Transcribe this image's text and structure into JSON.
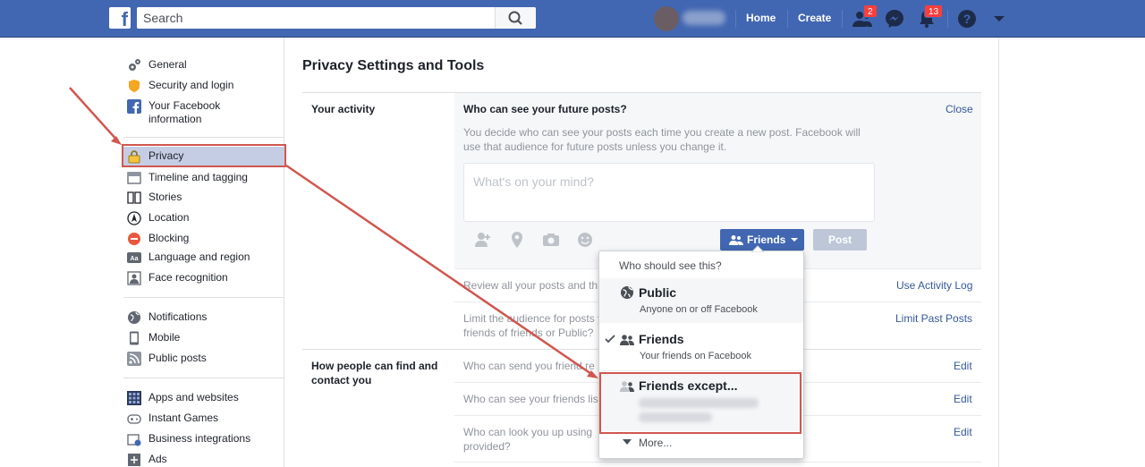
{
  "topbar": {
    "search_placeholder": "Search",
    "home": "Home",
    "create": "Create",
    "friend_requests_count": "2",
    "notifications_count": "13"
  },
  "sidebar": {
    "items": [
      {
        "label": "General"
      },
      {
        "label": "Security and login"
      },
      {
        "label": "Your Facebook information"
      },
      {
        "label": "Privacy"
      },
      {
        "label": "Timeline and tagging"
      },
      {
        "label": "Stories"
      },
      {
        "label": "Location"
      },
      {
        "label": "Blocking"
      },
      {
        "label": "Language and region"
      },
      {
        "label": "Face recognition"
      },
      {
        "label": "Notifications"
      },
      {
        "label": "Mobile"
      },
      {
        "label": "Public posts"
      },
      {
        "label": "Apps and websites"
      },
      {
        "label": "Instant Games"
      },
      {
        "label": "Business integrations"
      },
      {
        "label": "Ads"
      }
    ]
  },
  "main": {
    "title": "Privacy Settings and Tools",
    "your_activity": {
      "label": "Your activity",
      "question": "Who can see your future posts?",
      "close": "Close",
      "description": "You decide who can see your posts each time you create a new post. Facebook will use that audience for future posts unless you change it.",
      "composer_placeholder": "What's on your mind?",
      "audience_button": "Friends",
      "post_button": "Post",
      "review_text": "Review all your posts and thi",
      "review_link": "Use Activity Log",
      "limit_text_1": "Limit the audience for posts y",
      "limit_text_2": "friends of friends or Public?",
      "limit_link": "Limit Past Posts"
    },
    "find_contact": {
      "label_1": "How people can find and",
      "label_2": "contact you",
      "rows": [
        {
          "text": "Who can send you friend re",
          "link": "Edit"
        },
        {
          "text": "Who can see your friends lis",
          "link": "Edit"
        },
        {
          "text": "Who can look you up using",
          "text2": "provided?",
          "link": "Edit"
        }
      ]
    }
  },
  "dropdown": {
    "header": "Who should see this?",
    "options": [
      {
        "title": "Public",
        "subtitle": "Anyone on or off Facebook"
      },
      {
        "title": "Friends",
        "subtitle": "Your friends on Facebook"
      },
      {
        "title": "Friends except..."
      }
    ],
    "more": "More..."
  },
  "colors": {
    "brand": "#4267b2",
    "link": "#365899",
    "annotation": "#d0574f",
    "badge": "#fa3e3e"
  }
}
